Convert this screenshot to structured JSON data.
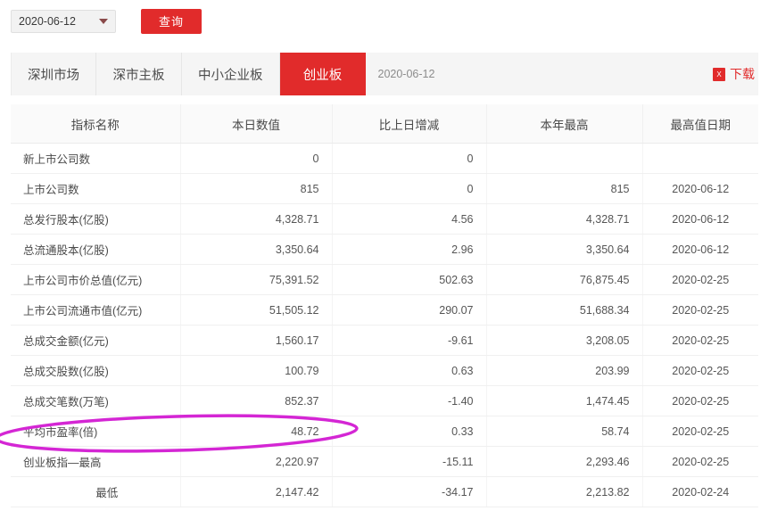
{
  "toolbar": {
    "date_value": "2020-06-12",
    "caret_icon": "chevron-down-icon",
    "query_label": "查询"
  },
  "tabs": {
    "items": [
      {
        "label": "深圳市场",
        "active": false
      },
      {
        "label": "深市主板",
        "active": false
      },
      {
        "label": "中小企业板",
        "active": false
      },
      {
        "label": "创业板",
        "active": true
      }
    ],
    "date_label": "2020-06-12",
    "download_label": "下载",
    "download_icon": "excel-file-icon"
  },
  "table": {
    "headers": [
      "指标名称",
      "本日数值",
      "比上日增减",
      "本年最高",
      "最高值日期"
    ],
    "rows": [
      {
        "label": "新上市公司数",
        "today": "0",
        "change": "0",
        "yearhigh": "",
        "highdate": "",
        "indent": false
      },
      {
        "label": "上市公司数",
        "today": "815",
        "change": "0",
        "yearhigh": "815",
        "highdate": "2020-06-12",
        "indent": false
      },
      {
        "label": "总发行股本(亿股)",
        "today": "4,328.71",
        "change": "4.56",
        "yearhigh": "4,328.71",
        "highdate": "2020-06-12",
        "indent": false
      },
      {
        "label": "总流通股本(亿股)",
        "today": "3,350.64",
        "change": "2.96",
        "yearhigh": "3,350.64",
        "highdate": "2020-06-12",
        "indent": false
      },
      {
        "label": "上市公司市价总值(亿元)",
        "today": "75,391.52",
        "change": "502.63",
        "yearhigh": "76,875.45",
        "highdate": "2020-02-25",
        "indent": false
      },
      {
        "label": "上市公司流通市值(亿元)",
        "today": "51,505.12",
        "change": "290.07",
        "yearhigh": "51,688.34",
        "highdate": "2020-02-25",
        "indent": false
      },
      {
        "label": "总成交金额(亿元)",
        "today": "1,560.17",
        "change": "-9.61",
        "yearhigh": "3,208.05",
        "highdate": "2020-02-25",
        "indent": false
      },
      {
        "label": "总成交股数(亿股)",
        "today": "100.79",
        "change": "0.63",
        "yearhigh": "203.99",
        "highdate": "2020-02-25",
        "indent": false
      },
      {
        "label": "总成交笔数(万笔)",
        "today": "852.37",
        "change": "-1.40",
        "yearhigh": "1,474.45",
        "highdate": "2020-02-25",
        "indent": false
      },
      {
        "label": "平均市盈率(倍)",
        "today": "48.72",
        "change": "0.33",
        "yearhigh": "58.74",
        "highdate": "2020-02-25",
        "indent": false
      },
      {
        "label": "创业板指—最高",
        "today": "2,220.97",
        "change": "-15.11",
        "yearhigh": "2,293.46",
        "highdate": "2020-02-25",
        "indent": false
      },
      {
        "label": "最低",
        "today": "2,147.42",
        "change": "-34.17",
        "yearhigh": "2,213.82",
        "highdate": "2020-02-24",
        "indent": true
      }
    ]
  },
  "annotation": {
    "shape": "ellipse",
    "color": "#d426d4",
    "target_row_label": "平均市盈率(倍)",
    "target_value": "48.72"
  },
  "colors": {
    "accent": "#e12b2b",
    "annotation": "#d426d4",
    "header_bg": "#fafafa",
    "tabbar_bg": "#f5f5f5"
  }
}
